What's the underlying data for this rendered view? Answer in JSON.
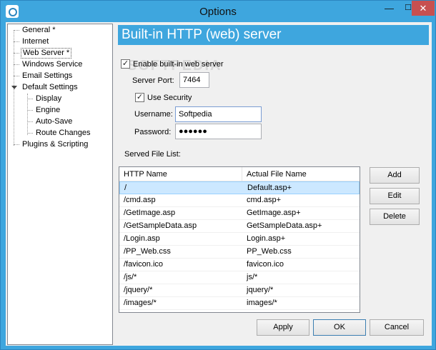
{
  "window": {
    "title": "Options",
    "min_glyph": "—",
    "max_glyph": "☐",
    "close_glyph": "✕"
  },
  "tree": {
    "items": [
      {
        "label": "General *"
      },
      {
        "label": "Internet"
      },
      {
        "label": "Web Server *"
      },
      {
        "label": "Windows Service"
      },
      {
        "label": "Email Settings"
      },
      {
        "label": "Default Settings"
      },
      {
        "label": "Display"
      },
      {
        "label": "Engine"
      },
      {
        "label": "Auto-Save"
      },
      {
        "label": "Route Changes"
      },
      {
        "label": "Plugins & Scripting"
      }
    ]
  },
  "panel": {
    "title": "Built-in HTTP (web) server",
    "watermark": "SOFTPEDIA",
    "enable_label": "Enable built-in web server",
    "enable_checked": true,
    "port_label": "Server Port:",
    "port_value": "7464",
    "security_label": "Use Security",
    "security_checked": true,
    "username_label": "Username:",
    "username_value": "Softpedia",
    "password_label": "Password:",
    "password_value": "●●●●●●",
    "served_label": "Served File List:"
  },
  "file_list": {
    "columns": [
      "HTTP Name",
      "Actual File Name"
    ],
    "rows": [
      [
        "/",
        "Default.asp+"
      ],
      [
        "/cmd.asp",
        "cmd.asp+"
      ],
      [
        "/GetImage.asp",
        "GetImage.asp+"
      ],
      [
        "/GetSampleData.asp",
        "GetSampleData.asp+"
      ],
      [
        "/Login.asp",
        "Login.asp+"
      ],
      [
        "/PP_Web.css",
        "PP_Web.css"
      ],
      [
        "/favicon.ico",
        "favicon.ico"
      ],
      [
        "/js/*",
        "js/*"
      ],
      [
        "/jquery/*",
        "jquery/*"
      ],
      [
        "/images/*",
        "images/*"
      ]
    ]
  },
  "buttons": {
    "add": "Add",
    "edit": "Edit",
    "delete": "Delete",
    "apply": "Apply",
    "ok": "OK",
    "cancel": "Cancel"
  },
  "colors": {
    "accent": "#3ea6de",
    "selection": "#cce8ff",
    "close": "#c75050"
  }
}
